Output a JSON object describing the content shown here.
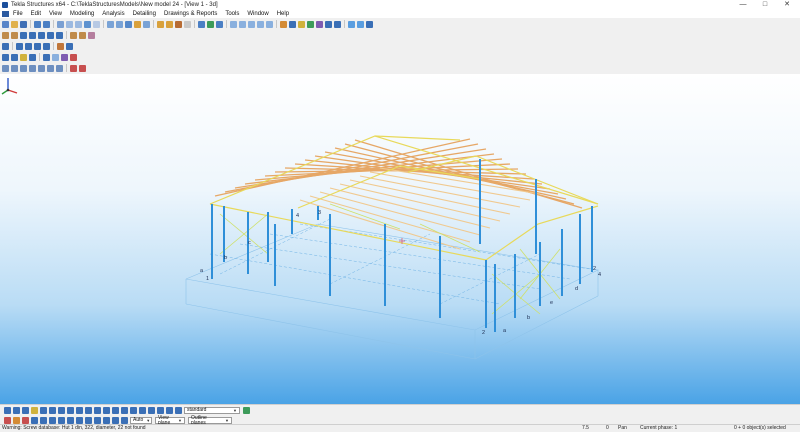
{
  "window": {
    "title": "Tekla Structures x64 - C:\\TeklaStructuresModels\\New model 24 - [View 1 - 3d]",
    "controls": [
      "—",
      "□",
      "✕"
    ]
  },
  "menu": {
    "items": [
      "File",
      "Edit",
      "View",
      "Modeling",
      "Analysis",
      "Detailing",
      "Drawings & Reports",
      "Tools",
      "Window",
      "Help"
    ]
  },
  "colors": {
    "accent": "#1b4f9c",
    "steel_columns": "#2f8fd8",
    "purlins": "#e6a766",
    "bracing": "#e8d95a",
    "viewport_bottom": "#4aa3e6"
  },
  "model": {
    "grid_labels": {
      "left_a": "a",
      "left_1": "1",
      "left_b": "b",
      "left_c": "c",
      "back_4": "4",
      "back_3": "3",
      "front_2": "2",
      "front_a": "a",
      "front_b": "b",
      "front_e": "e",
      "front_d": "d",
      "right_2": "2",
      "right_4": "4"
    }
  },
  "bottom_toolbar": {
    "selection_filter": "standard",
    "snap_mode": "Auto",
    "plane": "View plane",
    "planes_display": "Outline planes"
  },
  "status": {
    "message": "Warning: Screw database: Hut 1 din, 322, diameter, 22 not found",
    "coord": "7.5",
    "zero": "0",
    "pan": "Pan",
    "phase": "Current phase: 1",
    "selection": "0 + 0 object(s) selected"
  }
}
